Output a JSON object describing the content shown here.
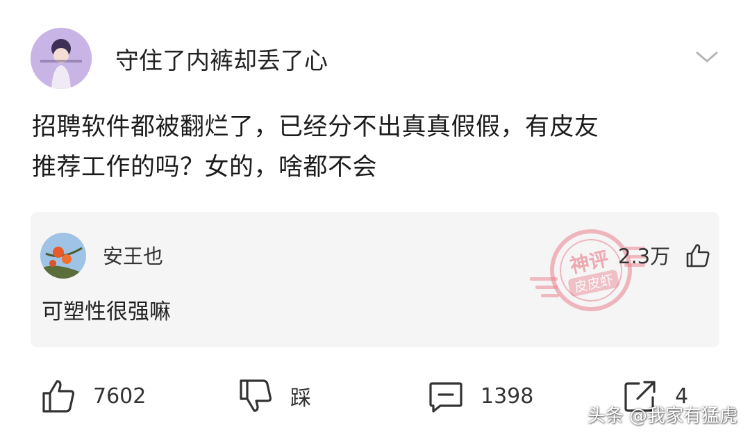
{
  "post": {
    "username": "守住了内裤却丢了心",
    "content_line1": "招聘软件都被翻烂了，已经分不出真真假假，有皮友",
    "content_line2": "推荐工作的吗？女的，啥都不会"
  },
  "top_reply": {
    "username": "安王也",
    "likes": "2.3万",
    "content": "可塑性很强嘛",
    "stamp_top_text": "神评",
    "stamp_bottom_text": "皮皮虾"
  },
  "actions": {
    "likes": "7602",
    "dislike_label": "踩",
    "comments": "1398",
    "shares": "4"
  },
  "watermark": "头条 @我家有猛虎",
  "colors": {
    "stamp": "#e9808c",
    "card_background": "#f5f5f5",
    "avatar_background": "#c8b5e6"
  }
}
